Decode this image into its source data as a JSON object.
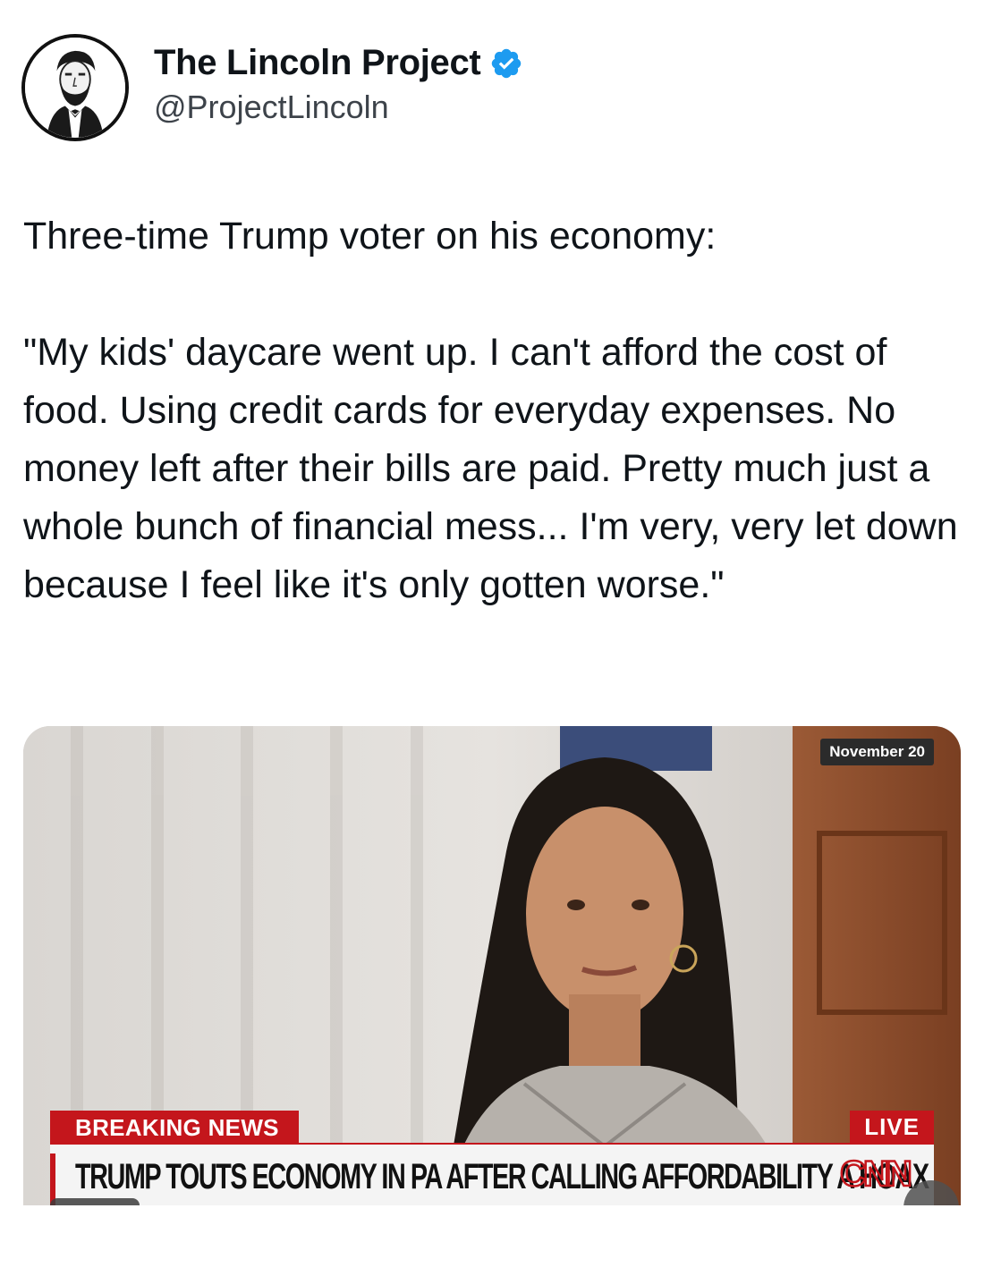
{
  "author": {
    "display_name": "The Lincoln Project",
    "handle": "@ProjectLincoln",
    "avatar_icon": "lincoln-portrait-icon",
    "verified_icon": "verified-badge-icon",
    "verified_color": "#1d9bf0"
  },
  "tweet": {
    "intro": "Three-time Trump voter on his economy:",
    "quote": "\"My kids' daycare went up. I can't afford the cost of food. Using credit cards for everyday expenses. No money left after their bills are paid. Pretty much just a whole bunch of financial mess... I'm very, very let down because I feel like it's only gotten worse.\""
  },
  "media": {
    "date_tag": "November 20",
    "breaking_label": "BREAKING NEWS",
    "live_label": "LIVE",
    "chyron": "TRUMP TOUTS ECONOMY IN PA AFTER CALLING AFFORDABILITY A HOAX",
    "network_logo": "CNN",
    "accent_color": "#c4161c",
    "mute_icon": "speaker-mute-icon"
  }
}
